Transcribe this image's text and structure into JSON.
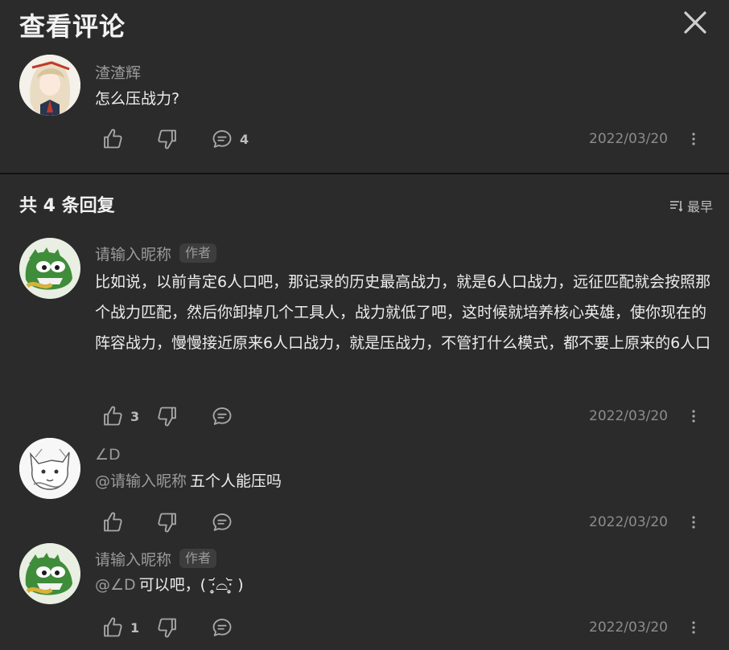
{
  "header": {
    "title": "查看评论"
  },
  "main_comment": {
    "author": "渣渣辉",
    "text": "怎么压战力?",
    "likes": "",
    "replies": "4",
    "date": "2022/03/20"
  },
  "replies_header": {
    "count_label": "共 4 条回复",
    "sort_label": "最早"
  },
  "replies": [
    {
      "author": "请输入昵称",
      "badge": "作者",
      "text": "比如说，以前肯定6人口吧，那记录的历史最高战力，就是6人口战力，远征匹配就会按照那个战力匹配，然后你卸掉几个工具人，战力就低了吧，这时候就培养核心英雄，使你现在的阵容战力，慢慢接近原来6人口战力，就是压战力，不管打什么模式，都不要上原来的6人口",
      "likes": "3",
      "date": "2022/03/20"
    },
    {
      "author": "∠D",
      "mention": "@请输入昵称",
      "text": "五个人能压吗",
      "likes": "",
      "date": "2022/03/20"
    },
    {
      "author": "请输入昵称",
      "badge": "作者",
      "mention": "@∠D",
      "text": "可以吧，( ·̥̥̥᷄⌓·̥̥̥᷅ )",
      "likes": "1",
      "date": "2022/03/20"
    }
  ],
  "colors": {
    "background": "#2b2b2b",
    "text": "#e8e8e8",
    "muted": "#9a9a9a"
  },
  "icons": [
    "close-icon",
    "thumbs-up-icon",
    "thumbs-down-icon",
    "comment-icon",
    "more-vertical-icon",
    "sort-icon"
  ]
}
